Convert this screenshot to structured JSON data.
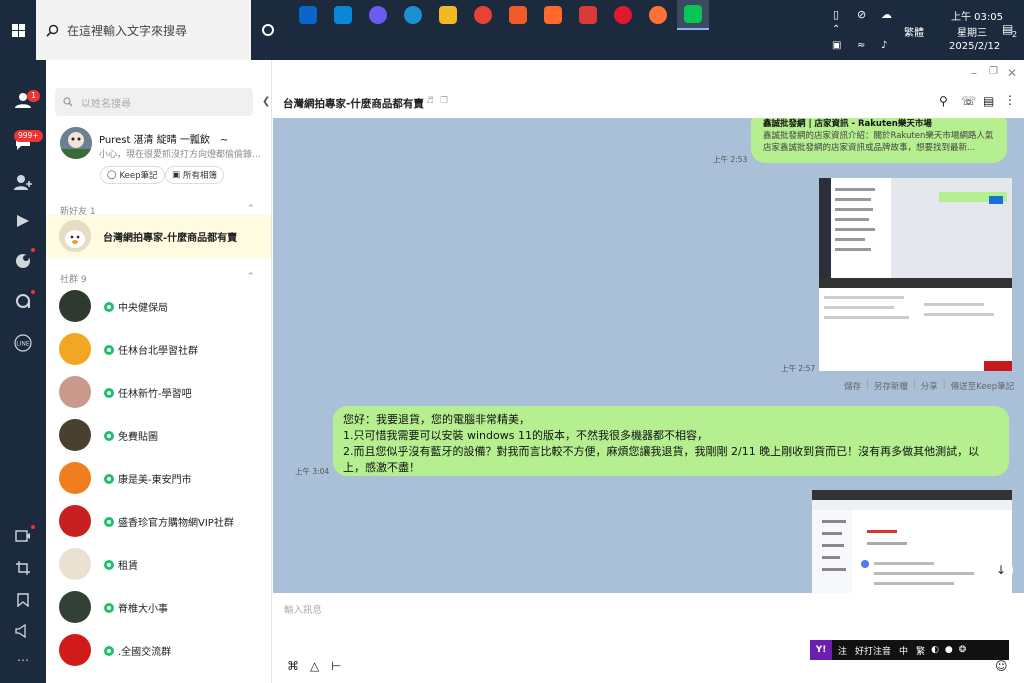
{
  "taskbar": {
    "search_placeholder": "在這裡輸入文字來搜尋",
    "apps": [
      {
        "name": "outlook",
        "color": "#0a64c9"
      },
      {
        "name": "store",
        "color": "#0a87d8"
      },
      {
        "name": "copilot",
        "color": "#6b5cf0"
      },
      {
        "name": "edge",
        "color": "#1c8fd1"
      },
      {
        "name": "files",
        "color": "#f2b826"
      },
      {
        "name": "chrome",
        "color": "#e94235"
      },
      {
        "name": "brave",
        "color": "#f15a29"
      },
      {
        "name": "app-orange",
        "color": "#ff6a2c"
      },
      {
        "name": "vivaldi",
        "color": "#d83a3a"
      },
      {
        "name": "opera",
        "color": "#e0192c"
      },
      {
        "name": "firefox",
        "color": "#ff7139"
      },
      {
        "name": "line",
        "color": "#06c755"
      }
    ],
    "ime_mode": "繁體",
    "time": "上午 03:05",
    "weekday": "星期三",
    "date": "2025/2/12",
    "notif_count": "2"
  },
  "sidebar": {
    "friend_badge": "1",
    "chat_badge": "999+"
  },
  "list": {
    "search_placeholder": "以姓名搜尋",
    "profile": {
      "name": "Purest 湛清 綻晴 一瓢飲　~",
      "status": "小心，現在很愛抓沒打方向燈都偷偷錄...",
      "keep_label": "Keep筆記",
      "album_label": "所有相簿"
    },
    "new_friends_header": "新好友 1",
    "new_friend": "台灣網拍專家-什麼商品都有賣",
    "groups_header": "社群 9",
    "groups": [
      "中央健保局",
      "任林台北學習社群",
      "任林新竹-學習吧",
      "免費貼圖",
      "康是美-東安門市",
      "盛香珍官方購物網VIP社群",
      "租賃",
      "脊椎大小事",
      ".全國交流群"
    ]
  },
  "chat": {
    "title": "台灣網拍專家-什麼商品都有賣",
    "msg1_title": "鑫誠批發網 | 店家資訊 - Rakuten樂天市場",
    "msg1_text": "鑫誠批發網的店家資訊介紹：關於Rakuten樂天市場網路人氣店家鑫誠批發網的店家資訊或品牌故事，想要找到最新...",
    "msg1_time": "上午 2:53",
    "img1_time": "上午 2:57",
    "img_actions": [
      "儲存",
      "另存新檔",
      "分享",
      "傳送至Keep筆記"
    ],
    "msg2_lines": [
      "您好：我要退貨，您的電腦非常精美，",
      "1.只可惜我需要可以安裝 windows 11的版本，不然我很多機器都不相容，",
      "2.而且您似乎沒有藍牙的設備？對我而言比較不方便，麻煩您讓我退貨，我剛剛 2/11 晚上剛收到貨而已！沒有再多做其他測試，以",
      "上，感激不盡！"
    ],
    "msg2_time": "上午 3:04",
    "input_placeholder": "輸入訊息",
    "ime_items": [
      "注",
      "好打注音",
      "中",
      "繁"
    ]
  }
}
